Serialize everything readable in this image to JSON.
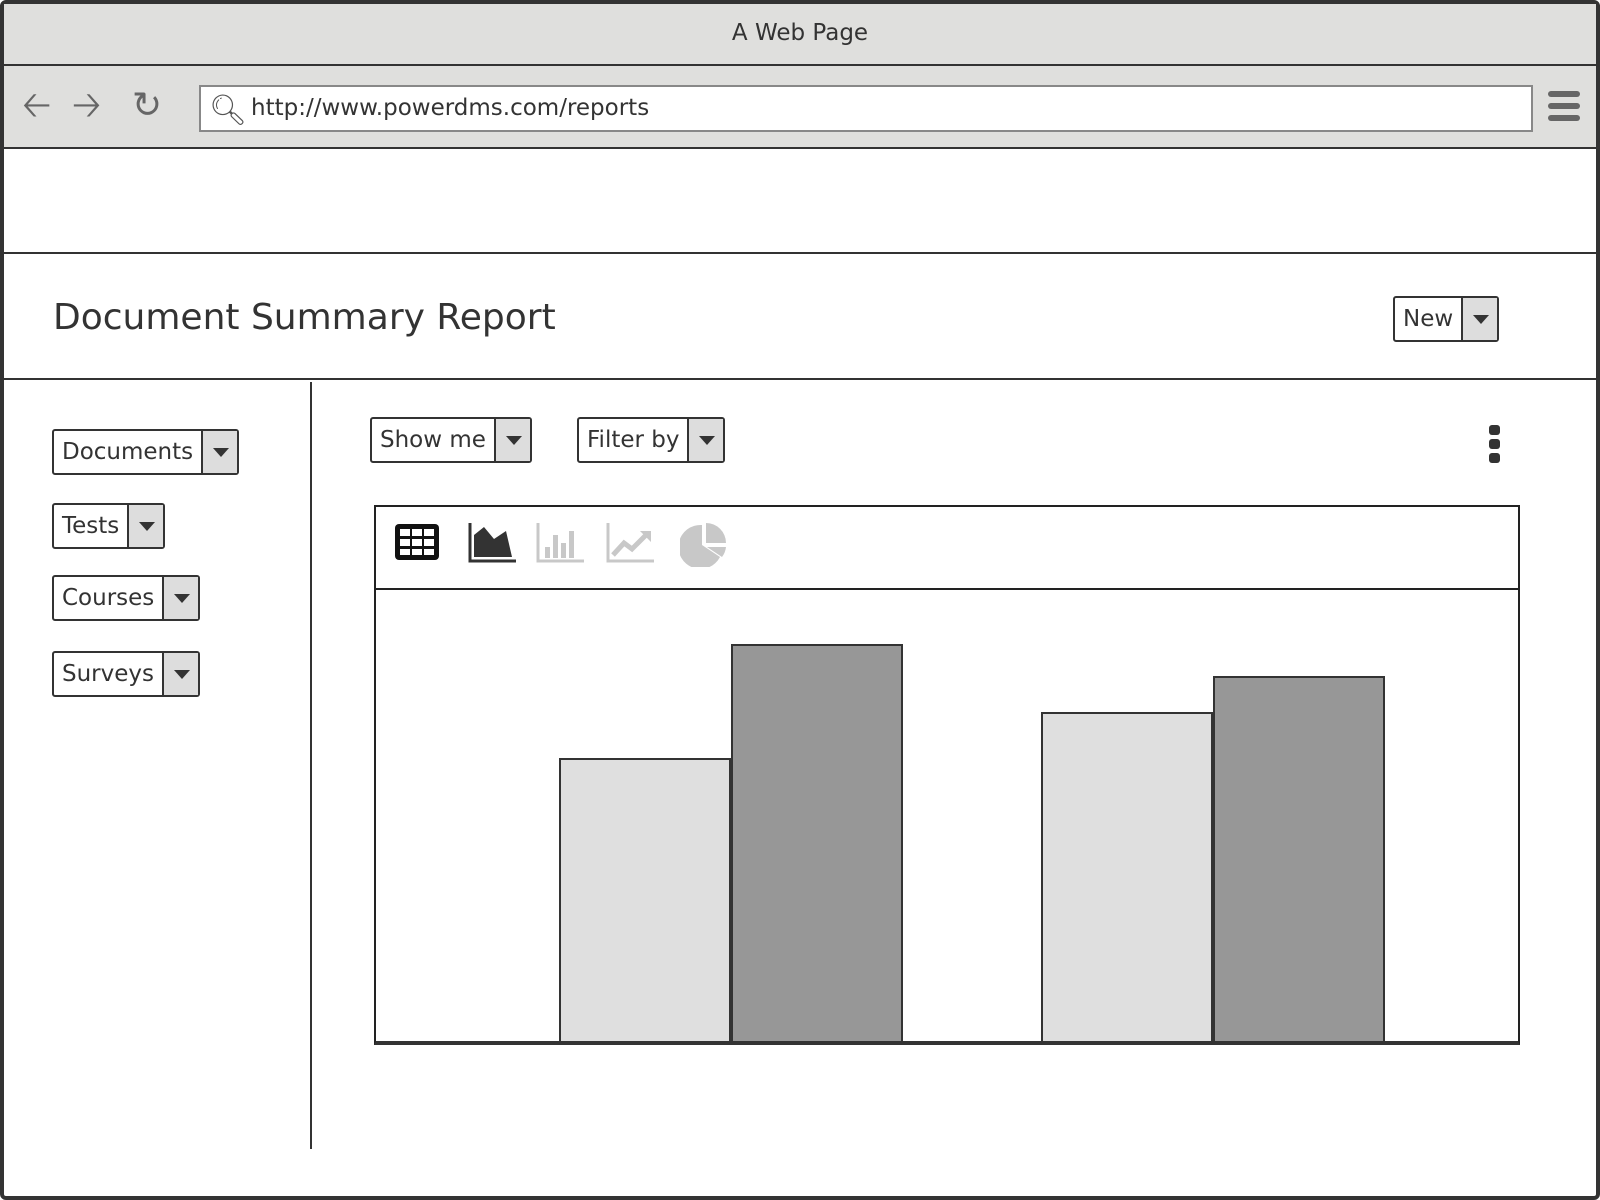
{
  "window": {
    "title": "A Web Page"
  },
  "browser": {
    "url": "http://www.powerdms.com/reports",
    "icons": [
      "back-arrow-icon",
      "forward-arrow-icon",
      "reload-icon",
      "search-icon",
      "hamburger-menu-icon"
    ]
  },
  "header": {
    "title": "Document Summary Report",
    "new_label": "New"
  },
  "sidebar": {
    "items": [
      {
        "label": "Documents"
      },
      {
        "label": "Tests"
      },
      {
        "label": "Courses"
      },
      {
        "label": "Surveys"
      }
    ]
  },
  "toolbar": {
    "show_me": "Show me",
    "filter_by": "Filter by"
  },
  "chart_toolbar": {
    "icons": [
      {
        "name": "table-icon",
        "active": true
      },
      {
        "name": "area-chart-icon",
        "active": true
      },
      {
        "name": "bar-chart-icon",
        "active": false
      },
      {
        "name": "line-chart-icon",
        "active": false
      },
      {
        "name": "pie-chart-icon",
        "active": false
      }
    ]
  },
  "colors": {
    "series_light": "#dfdfdf",
    "series_dark": "#979797",
    "active_icon": "#222222",
    "inactive_icon": "#c8c8c8"
  },
  "chart_data": {
    "type": "bar",
    "categories": [
      "",
      ""
    ],
    "series": [
      {
        "values": [
          63,
          73
        ],
        "color": "#dfdfdf"
      },
      {
        "values": [
          88,
          81
        ],
        "color": "#979797"
      }
    ],
    "grouping": "interleaved",
    "bars": [
      63,
      73,
      88,
      81
    ],
    "ylim": [
      0,
      100
    ],
    "grid": false,
    "axes_labels": false
  }
}
